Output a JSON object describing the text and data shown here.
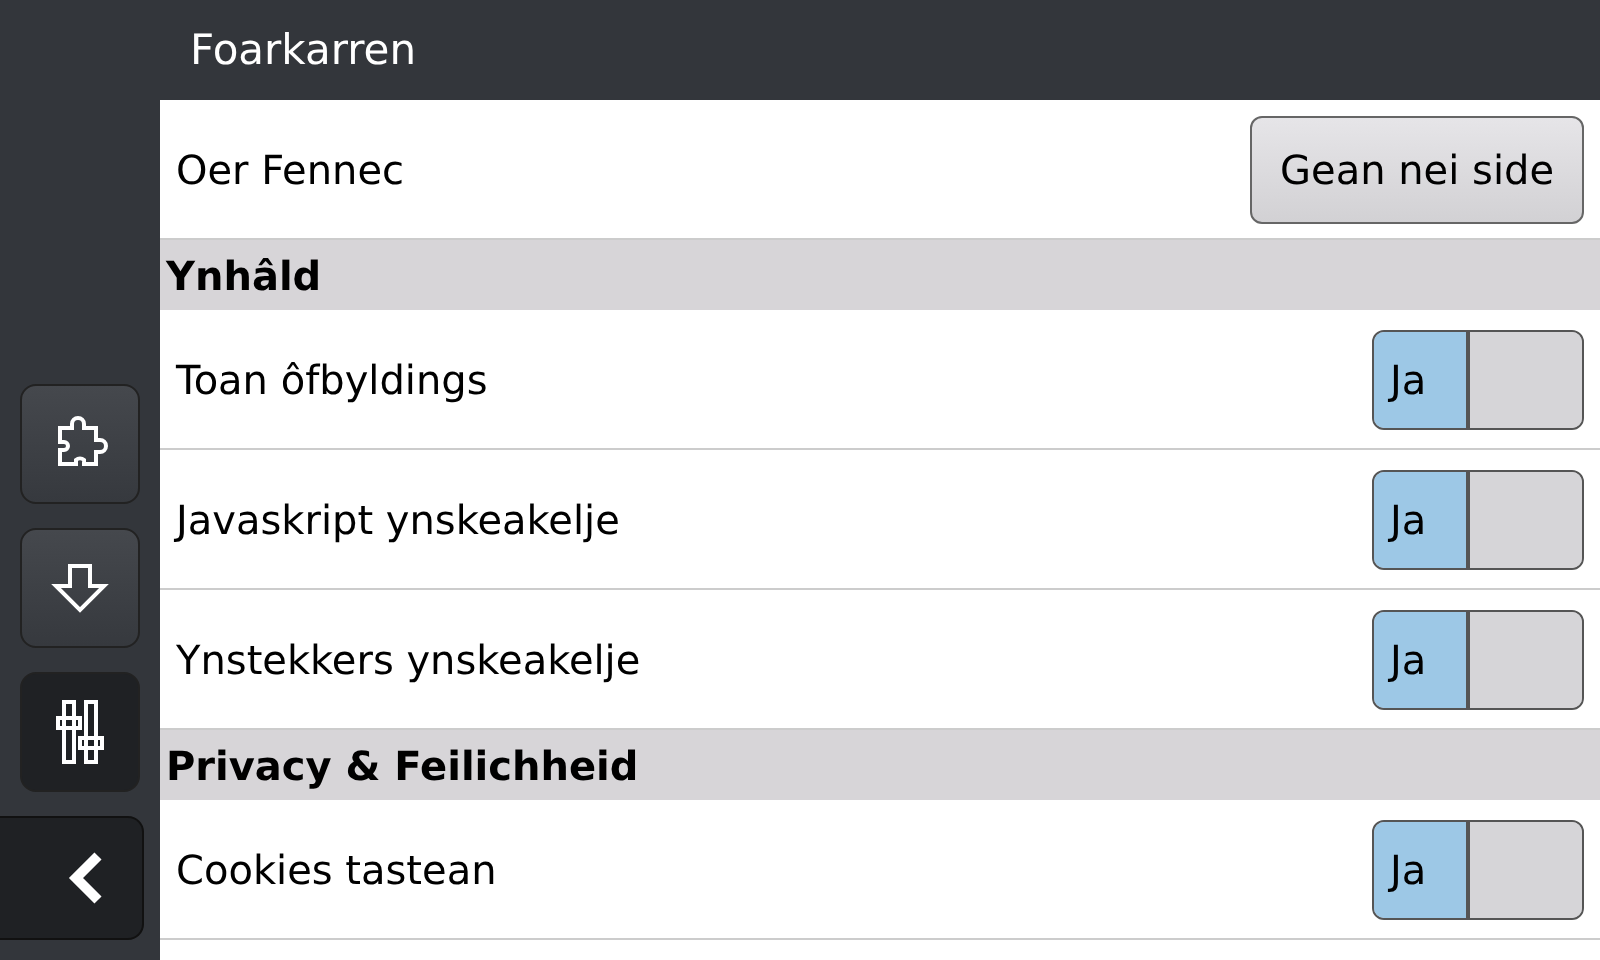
{
  "sidebar": {
    "items": [
      {
        "kind": "addons",
        "selected": false
      },
      {
        "kind": "downloads",
        "selected": false
      },
      {
        "kind": "preferences",
        "selected": true
      }
    ]
  },
  "header": {
    "title": "Foarkarren"
  },
  "sections": [
    {
      "rows": [
        {
          "kind": "button",
          "label": "Oer Fennec",
          "button": "Gean nei side"
        }
      ]
    },
    {
      "title": "Ynhâld",
      "rows": [
        {
          "kind": "toggle",
          "label": "Toan ôfbyldings",
          "on": true,
          "value": "Ja"
        },
        {
          "kind": "toggle",
          "label": "Javaskript ynskeakelje",
          "on": true,
          "value": "Ja"
        },
        {
          "kind": "toggle",
          "label": "Ynstekkers ynskeakelje",
          "on": true,
          "value": "Ja"
        }
      ]
    },
    {
      "title": "Privacy & Feilichheid",
      "rows": [
        {
          "kind": "toggle",
          "label": "Cookies tastean",
          "on": true,
          "value": "Ja"
        }
      ]
    }
  ]
}
